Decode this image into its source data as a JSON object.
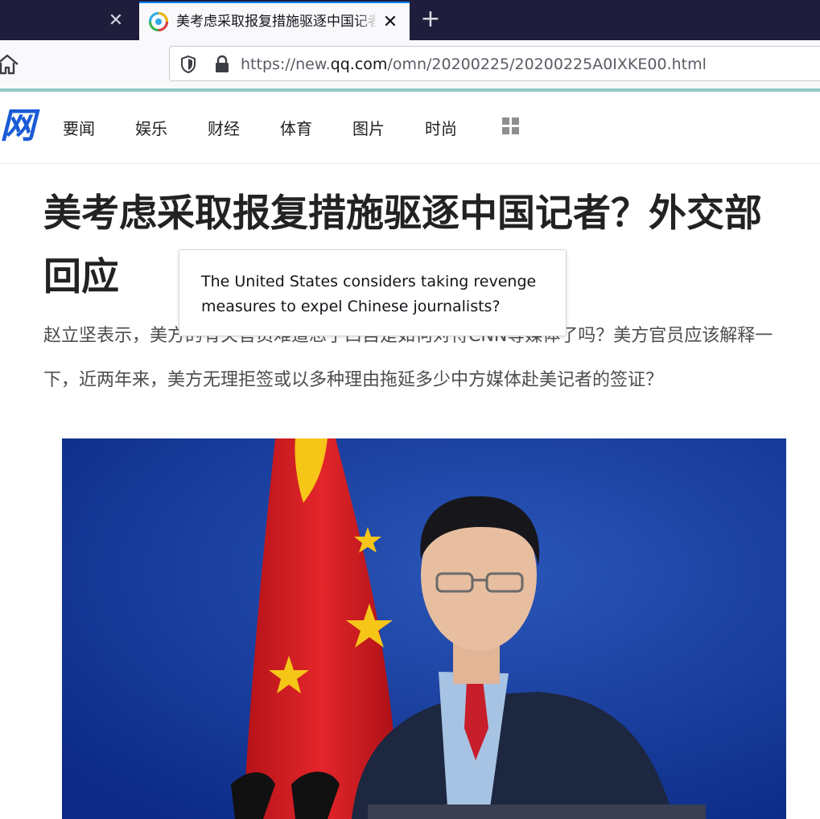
{
  "browser": {
    "active_tab": {
      "title": "美考虑采取报复措施驱逐中国记者？外交部回应",
      "favicon": "qq-news-favicon"
    },
    "url": {
      "prefix": "https://new.",
      "domain": "qq.com",
      "path": "/omn/20200225/20200225A0IXKE00.html"
    },
    "icons": {
      "prev_tab_close": "✕",
      "tab_close": "✕",
      "new_tab": "+"
    }
  },
  "site": {
    "logo": "网",
    "nav": [
      "要闻",
      "娱乐",
      "财经",
      "体育",
      "图片",
      "时尚"
    ],
    "accent_color": "#1a5bd6"
  },
  "article": {
    "headline": "美考虑采取报复措施驱逐中国记者？外交部回应",
    "summary": "赵立坚表示，美方的有关官员难道忘了曰自是如何对待CNN等媒体了吗？美方官员应该解释一下，近两年来，美方无理拒签或以多种理由拖延多少中方媒体赴美记者的签证？"
  },
  "tooltip": {
    "text": "The United States considers taking revenge measures to expel Chinese journalists?"
  },
  "photo": {
    "subject": "press-briefing-photo"
  }
}
